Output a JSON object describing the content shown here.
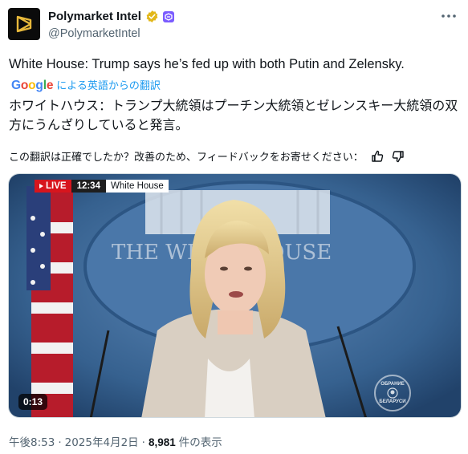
{
  "author": {
    "display_name": "Polymarket Intel",
    "handle": "@PolymarketIntel",
    "avatar_icon": "polymarket-logo-icon",
    "verified_icon": "verified-badge-icon",
    "affiliation_icon": "affiliate-badge-icon"
  },
  "post": {
    "original_text": "White House: Trump says he’s fed up with both Putin and Zelensky.",
    "google_logo": "Google",
    "translation_label": "による英語からの翻訳",
    "translated_text": "ホワイトハウス：トランプ大統領はプーチン大統領とゼレンスキー大統領の双方にうんざりしていると発言。",
    "feedback_prompt": "この翻訳は正確でしたか？改善のため、フィードバックをお寄せください："
  },
  "video": {
    "live_label": "LIVE",
    "clock": "12:34",
    "location": "White House",
    "podium_text": "THE WHITE HOUSE",
    "duration": "0:13",
    "seal_text_top": "ОБРАНИЕ",
    "seal_text_bottom": "БЕЛАРУСИ"
  },
  "meta": {
    "time": "午後8:53",
    "separator": "·",
    "date": "2025年4月2日",
    "views": "8,981",
    "views_label": "件の表示"
  },
  "colors": {
    "link_blue": "#1d9bf0",
    "secondary_text": "#536471",
    "live_red": "#d7151d",
    "backdrop_blue": "#3f6c9e",
    "verified_gold": "#e2b719"
  }
}
